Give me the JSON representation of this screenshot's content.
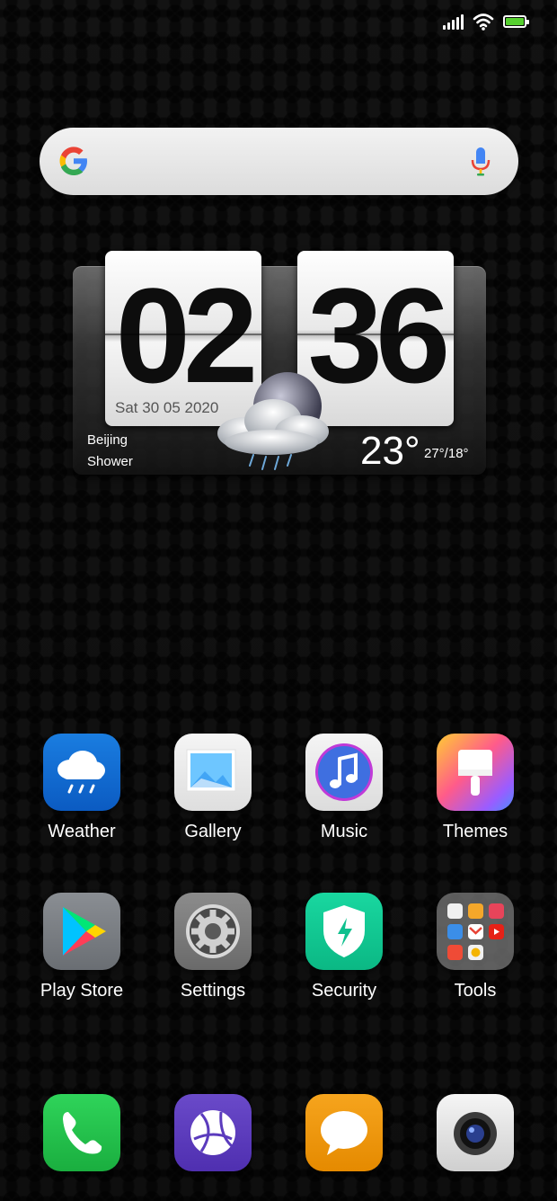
{
  "status_bar": {
    "battery_level": 1.0,
    "battery_color": "#56d02f"
  },
  "search": {
    "icons": [
      "google-icon",
      "mic-icon"
    ]
  },
  "clock_widget": {
    "hours": "02",
    "minutes": "36",
    "date": "Sat 30 05 2020",
    "city": "Beijing",
    "condition": "Shower",
    "temperature": "23°",
    "range": "27°/18°"
  },
  "apps": {
    "row1": [
      {
        "label": "Weather",
        "icon": "cloud-rain-icon"
      },
      {
        "label": "Gallery",
        "icon": "image-icon"
      },
      {
        "label": "Music",
        "icon": "music-note-icon"
      },
      {
        "label": "Themes",
        "icon": "paintbrush-icon"
      }
    ],
    "row2": [
      {
        "label": "Play Store",
        "icon": "play-triangle-icon"
      },
      {
        "label": "Settings",
        "icon": "gear-icon"
      },
      {
        "label": "Security",
        "icon": "shield-bolt-icon"
      },
      {
        "label": "Tools",
        "icon": "folder-grid-icon"
      }
    ],
    "dock": [
      {
        "icon": "phone-icon"
      },
      {
        "icon": "globe-icon"
      },
      {
        "icon": "chat-bubble-icon"
      },
      {
        "icon": "camera-icon"
      }
    ]
  }
}
